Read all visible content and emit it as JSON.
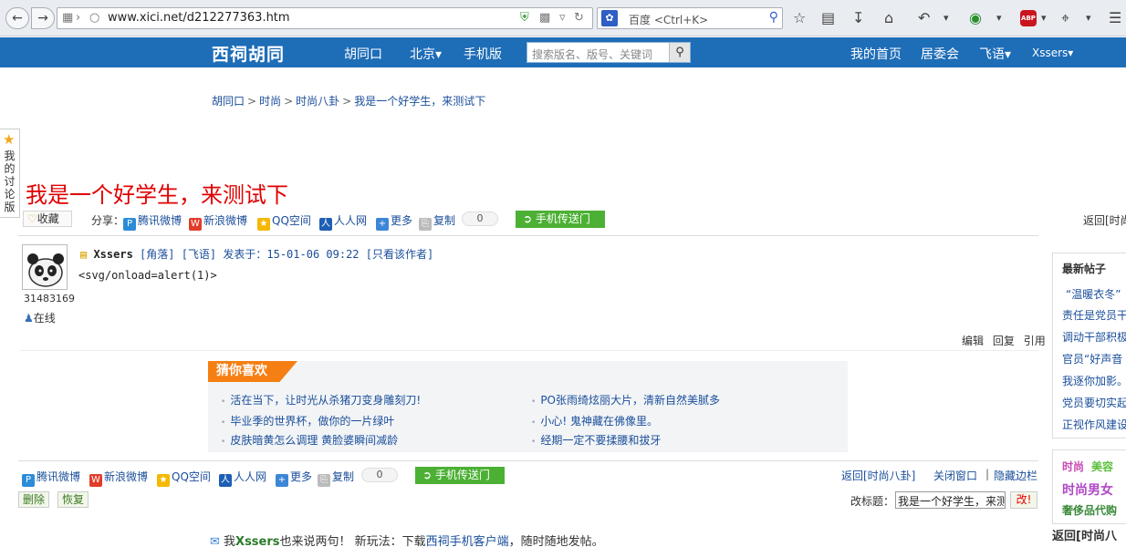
{
  "browser": {
    "url": "www.xici.net/d212277363.htm",
    "search_placeholder": "百度 <Ctrl+K>",
    "engine_icon": "baidu-icon",
    "abp_label": "ABP"
  },
  "header": {
    "logo": "西祠胡同",
    "nav": [
      "胡同口",
      "北京▾",
      "手机版"
    ],
    "search_placeholder": "搜索版名、版号、关键词",
    "right_nav": [
      "我的首页",
      "居委会",
      "飞语▾",
      "Xssers▾"
    ]
  },
  "breadcrumb": [
    "胡同口",
    "时尚",
    "时尚八卦",
    "我是一个好学生，来测试下"
  ],
  "side_tab": "我的讨论版",
  "thread": {
    "title": "我是一个好学生，来测试下",
    "fav_label": "收藏",
    "share_label": "分享：",
    "share_items": [
      "腾讯微博",
      "新浪微博",
      "QQ空间",
      "人人网",
      "更多",
      "复制"
    ],
    "share_count": "0",
    "phone_btn": "手机传送门",
    "back_text": "返回[时尚"
  },
  "post": {
    "author": "Xssers",
    "meta_rest": " [角落] [飞语] 发表于：15-01-06 09:22 [只看该作者]",
    "user_id": "31483169",
    "online": "在线",
    "content": "<svg/onload=alert(1)>",
    "ops": [
      "编辑",
      "回复",
      "引用"
    ]
  },
  "guess": {
    "heading": "猜你喜欢",
    "left": [
      "活在当下，让时光从杀猪刀变身雕刻刀!",
      "毕业季的世界杯，做你的一片绿叶",
      "皮肤暗黄怎么调理 黄脸婆瞬间减龄"
    ],
    "right": [
      "PO张雨绮炫丽大片，清新自然美腻多",
      "小心! 鬼神藏在佛像里。",
      "经期一定不要揉腰和拔牙"
    ]
  },
  "footer": {
    "share_items": [
      "腾讯微博",
      "新浪微博",
      "QQ空间",
      "人人网",
      "更多",
      "复制"
    ],
    "share_count": "0",
    "phone_btn": "手机传送门",
    "back": "返回[时尚八卦]",
    "close": "关闭窗口",
    "sep": "|",
    "hide_sidebar": "隐藏边栏",
    "delete_btn": "删除",
    "restore_btn": "恢复",
    "retitle_label": "改标题：",
    "retitle_value": "我是一个好学生，来测",
    "retitle_btn": "改!",
    "note_prefix": "我",
    "note_user": "Xssers",
    "note_mid": "也来说两句！  新玩法：下载",
    "note_link": "西祠手机客户端",
    "note_suffix": "，随时随地发帖。"
  },
  "sidebar": {
    "heading": "最新帖子",
    "items": [
      "“温暖衣冬”",
      "责任是党员干",
      "调动干部积极",
      "官员“好声音",
      "我逐你加影。",
      "党员要切实起",
      "正视作风建设"
    ],
    "tags": [
      "时尚",
      "美容",
      "时尚男女",
      "奢侈品代购"
    ],
    "back": "返回[时尚八"
  },
  "colors": {
    "header_blue": "#1e6db7",
    "title_red": "#e00000",
    "accent_orange": "#f57f13",
    "button_green": "#4cb034"
  }
}
